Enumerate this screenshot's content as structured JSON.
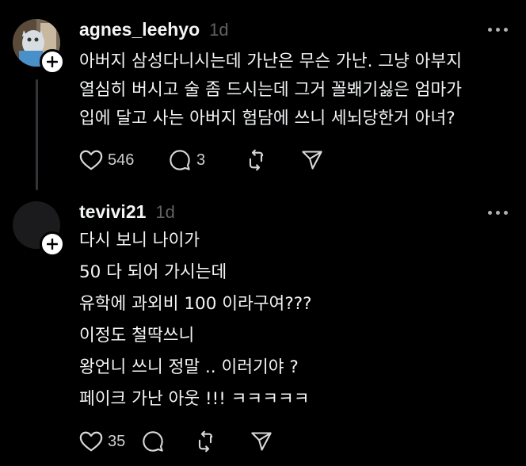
{
  "posts": [
    {
      "username": "agnes_leehyo",
      "time": "1d",
      "lines": [
        "아버지 삼성다니시는데 가난은 무슨 가난.  그냥 아부지",
        "열심히 버시고 술 좀 드시는데 그거 꼴봬기싫은 엄마가",
        "입에 달고 사는 아버지 험담에 쓰니 세뇌당한거 아녀?"
      ],
      "likes": "546",
      "replies": "3"
    },
    {
      "username": "tevivi21",
      "time": "1d",
      "lines": [
        "다시 보니 나이가",
        "50 다 되어 가시는데",
        "유학에 과외비 100 이라구여???",
        "이정도 철딱쓰니",
        "왕언니 쓰니 정말 .. 이러기야 ?",
        "페이크 가난 아웃 !!! ㅋㅋㅋㅋㅋ"
      ],
      "likes": "35",
      "replies": ""
    }
  ],
  "icons": {
    "like": "heart-icon",
    "reply": "comment-icon",
    "repost": "repost-icon",
    "share": "send-icon",
    "follow": "plus-icon",
    "more": "more-icon"
  }
}
